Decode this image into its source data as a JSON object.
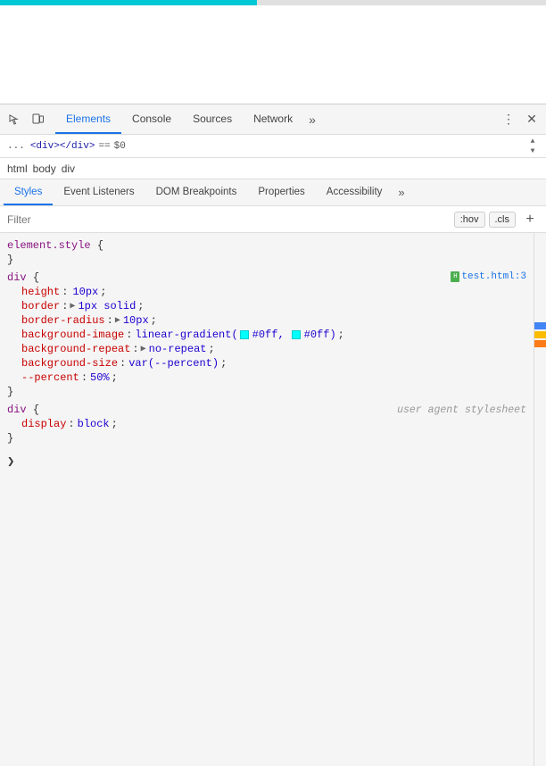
{
  "progressBar": {
    "fillPercent": 47,
    "color": "#00c8d4"
  },
  "toolbar": {
    "tabs": [
      {
        "id": "elements",
        "label": "Elements",
        "active": true
      },
      {
        "id": "console",
        "label": "Console",
        "active": false
      },
      {
        "id": "sources",
        "label": "Sources",
        "active": false
      },
      {
        "id": "network",
        "label": "Network",
        "active": false
      }
    ],
    "moreLabel": "»",
    "menuLabel": "⋮",
    "closeLabel": "✕"
  },
  "breadcrumb": {
    "dots": "...",
    "tag": "<div></div>",
    "equals": "==",
    "dollar": "$0"
  },
  "pathBar": {
    "items": [
      "html",
      "body",
      "div"
    ]
  },
  "subtabs": {
    "tabs": [
      {
        "id": "styles",
        "label": "Styles",
        "active": true
      },
      {
        "id": "event-listeners",
        "label": "Event Listeners",
        "active": false
      },
      {
        "id": "dom-breakpoints",
        "label": "DOM Breakpoints",
        "active": false
      },
      {
        "id": "properties",
        "label": "Properties",
        "active": false
      },
      {
        "id": "accessibility",
        "label": "Accessibility",
        "active": false
      }
    ],
    "moreLabel": "»"
  },
  "filter": {
    "placeholder": "Filter",
    "hovLabel": ":hov",
    "clsLabel": ".cls",
    "addLabel": "+"
  },
  "cssRules": [
    {
      "id": "element-style",
      "selector": "element.style {",
      "properties": [],
      "closeBrace": "}",
      "fileLink": null
    },
    {
      "id": "div-rule",
      "selector": "div {",
      "properties": [
        {
          "name": "height",
          "value": "10px",
          "colon": ":",
          "semicolon": ";"
        },
        {
          "name": "border",
          "hasExpand": true,
          "value": "1px solid",
          "colon": ":",
          "semicolon": ";"
        },
        {
          "name": "border-radius",
          "hasExpand": true,
          "value": "10px",
          "colon": ":",
          "semicolon": ";"
        },
        {
          "name": "background-image",
          "value": "linear-gradient(",
          "colon": ":",
          "semicolon": ";",
          "hasGradient": true,
          "gradientColors": [
            "#0ff",
            "#0ff"
          ]
        },
        {
          "name": "background-repeat",
          "hasExpand": true,
          "value": "no-repeat",
          "colon": ":",
          "semicolon": ";"
        },
        {
          "name": "background-size",
          "value": "var(--percent)",
          "colon": ":",
          "semicolon": ";"
        },
        {
          "name": "--percent",
          "value": "50%",
          "colon": ":",
          "semicolon": ";"
        }
      ],
      "closeBrace": "}",
      "fileLink": "test.html:3"
    },
    {
      "id": "div-user-agent",
      "selector": "div {",
      "userAgent": "user agent stylesheet",
      "properties": [
        {
          "name": "display",
          "value": "block",
          "colon": ":",
          "semicolon": ";"
        }
      ],
      "closeBrace": "}"
    }
  ]
}
